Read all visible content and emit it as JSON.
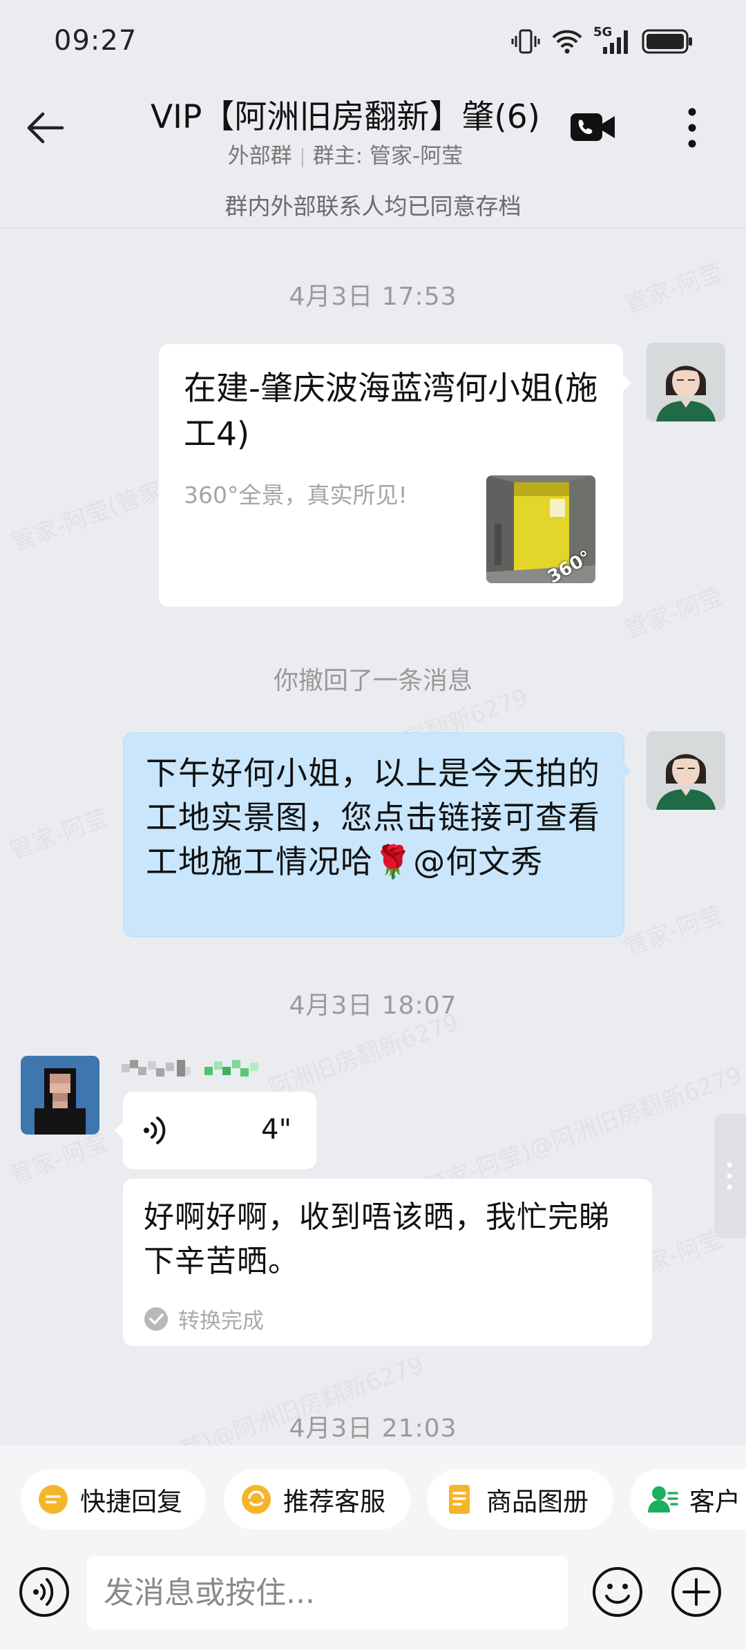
{
  "status_bar": {
    "time": "09:27",
    "network_label": "5G",
    "icons": [
      "vibrate-icon",
      "wifi-icon",
      "signal-icon",
      "battery-icon"
    ]
  },
  "header": {
    "title": "VIP【阿洲旧房翻新】肇(6)",
    "group_type": "外部群",
    "owner_label": "群主: 管家-阿莹",
    "archive_note": "群内外部联系人均已同意存档"
  },
  "watermark": "管家-阿莹)@阿洲旧房翻新6279",
  "messages": {
    "ts1": "4月3日  17:53",
    "link_card": {
      "title": "在建-肇庆波海蓝湾何小姐(施工4)",
      "description": "360°全景，真实所见!",
      "badge": "360°"
    },
    "recall_note": "你撤回了一条消息",
    "greeting": "下午好何小姐，以上是今天拍的工地实景图，您点击链接可查看工地施工情况哈🌹@何文秀",
    "ts2": "4月3日  18:07",
    "voice": {
      "duration": "4\""
    },
    "transcript": "好啊好啊，收到唔该晒，我忙完睇下辛苦晒。",
    "convert_status": "转换完成",
    "ts3": "4月3日  21:03"
  },
  "quick_actions": {
    "quick_reply": "快捷回复",
    "recommend_service": "推荐客服",
    "product_catalog": "商品图册",
    "customer": "客户"
  },
  "input": {
    "placeholder": "发消息或按住..."
  },
  "colors": {
    "background": "#ebecf0",
    "outgoing_bubble": "#c9e6fc",
    "chip_icon_yellow": "#f5b52b",
    "chip_icon_green": "#1bb05e"
  }
}
